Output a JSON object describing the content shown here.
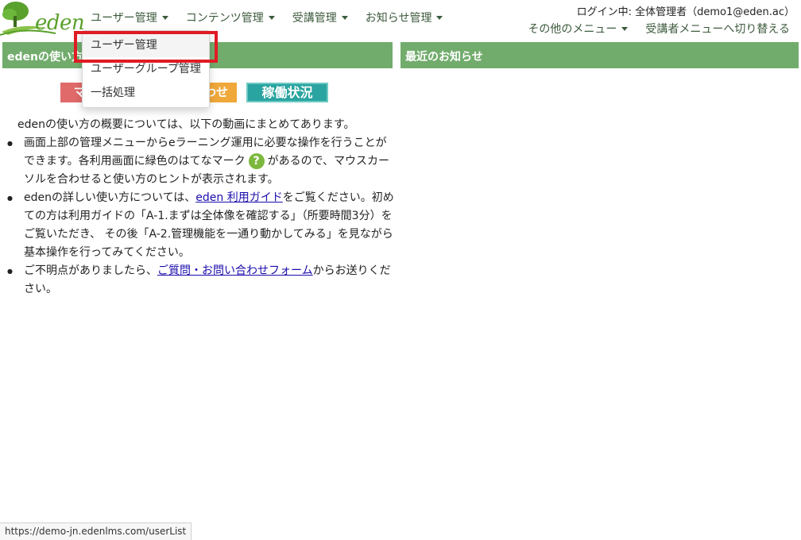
{
  "app": {
    "logo_text": "eden"
  },
  "nav": {
    "items": [
      {
        "label": "ユーザー管理"
      },
      {
        "label": "コンテンツ管理"
      },
      {
        "label": "受講管理"
      },
      {
        "label": "お知らせ管理"
      }
    ],
    "login_info": "ログイン中: 全体管理者（demo1@eden.ac）",
    "other_menu": "その他のメニュー",
    "switch_label": "受講者メニューへ切り替える"
  },
  "dropdown": {
    "items": [
      {
        "label": "ユーザー管理"
      },
      {
        "label": "ユーザーグループ管理"
      },
      {
        "label": "一括処理"
      }
    ]
  },
  "left_panel": {
    "title": "edenの使い方",
    "buttons": {
      "manual": "マニュアル",
      "contact": "お問い合わせ",
      "status": "稼働状況"
    },
    "intro": "edenの使い方の概要については、以下の動画にまとめてあります。",
    "bullets": {
      "b1_pre": "画面上部の管理メニューからeラーニング運用に必要な操作を行うことができます。各利用画面に緑色のはてなマーク",
      "b1_post": "があるので、マウスカーソルを合わせると使い方のヒントが表示されます。",
      "b2_pre": "edenの詳しい使い方については、",
      "b2_link": "eden 利用ガイド",
      "b2_post": "をご覧ください。初めての方は利用ガイドの「A-1.まずは全体像を確認する」（所要時間3分）をご覧いただき、 その後「A-2.管理機能を一通り動かしてみる」を見ながら基本操作を行ってみてください。",
      "b3_pre": "ご不明点がありましたら、",
      "b3_link": "ご質問・お問い合わせフォーム",
      "b3_post": "からお送りください。"
    },
    "help_mark": "?"
  },
  "right_panel": {
    "title": "最近のお知らせ"
  },
  "statusbar": {
    "url": "https://demo-jn.edenlms.com/userList"
  },
  "colors": {
    "panel_header": "#72ac6d",
    "highlight": "#e01b24",
    "help_icon": "#7cb83e"
  }
}
